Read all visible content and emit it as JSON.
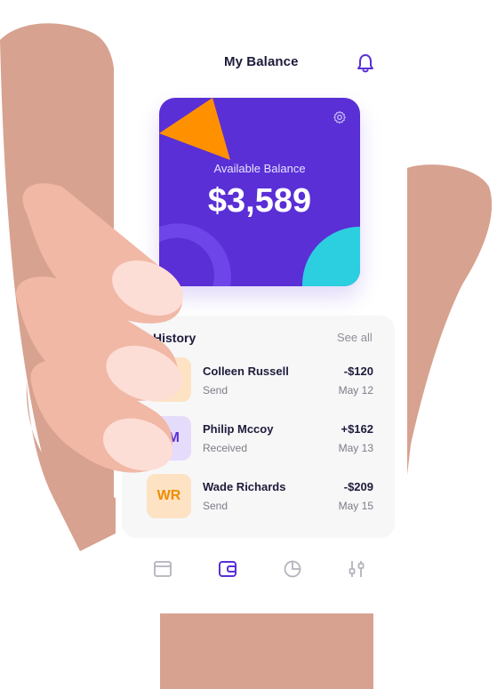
{
  "header": {
    "title": "My Balance"
  },
  "balance_card": {
    "label": "Available Balance",
    "amount": "$3,589"
  },
  "history": {
    "title": "History",
    "see_all": "See all",
    "rows": [
      {
        "initials": "",
        "name": "Colleen Russell",
        "type": "Send",
        "amount": "-$120",
        "date": "May 12"
      },
      {
        "initials": "PM",
        "name": "Philip Mccoy",
        "type": "Received",
        "amount": "+$162",
        "date": "May 13"
      },
      {
        "initials": "WR",
        "name": "Wade Richards",
        "type": "Send",
        "amount": "-$209",
        "date": "May 15"
      }
    ]
  },
  "bottom_nav": [
    "card-icon",
    "wallet-icon",
    "chart-icon",
    "settings-sliders-icon"
  ],
  "colors": {
    "accent": "#5a2fd6",
    "orange": "#ff9100",
    "cyan": "#2ccfe0",
    "skin": "#d7a290",
    "skin_light": "#f1b8a6"
  }
}
